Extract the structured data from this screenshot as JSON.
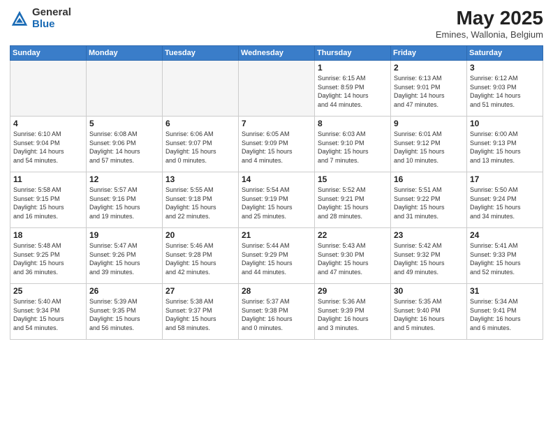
{
  "logo": {
    "general": "General",
    "blue": "Blue"
  },
  "title": "May 2025",
  "subtitle": "Emines, Wallonia, Belgium",
  "weekdays": [
    "Sunday",
    "Monday",
    "Tuesday",
    "Wednesday",
    "Thursday",
    "Friday",
    "Saturday"
  ],
  "weeks": [
    [
      {
        "day": "",
        "info": ""
      },
      {
        "day": "",
        "info": ""
      },
      {
        "day": "",
        "info": ""
      },
      {
        "day": "",
        "info": ""
      },
      {
        "day": "1",
        "info": "Sunrise: 6:15 AM\nSunset: 8:59 PM\nDaylight: 14 hours\nand 44 minutes."
      },
      {
        "day": "2",
        "info": "Sunrise: 6:13 AM\nSunset: 9:01 PM\nDaylight: 14 hours\nand 47 minutes."
      },
      {
        "day": "3",
        "info": "Sunrise: 6:12 AM\nSunset: 9:03 PM\nDaylight: 14 hours\nand 51 minutes."
      }
    ],
    [
      {
        "day": "4",
        "info": "Sunrise: 6:10 AM\nSunset: 9:04 PM\nDaylight: 14 hours\nand 54 minutes."
      },
      {
        "day": "5",
        "info": "Sunrise: 6:08 AM\nSunset: 9:06 PM\nDaylight: 14 hours\nand 57 minutes."
      },
      {
        "day": "6",
        "info": "Sunrise: 6:06 AM\nSunset: 9:07 PM\nDaylight: 15 hours\nand 0 minutes."
      },
      {
        "day": "7",
        "info": "Sunrise: 6:05 AM\nSunset: 9:09 PM\nDaylight: 15 hours\nand 4 minutes."
      },
      {
        "day": "8",
        "info": "Sunrise: 6:03 AM\nSunset: 9:10 PM\nDaylight: 15 hours\nand 7 minutes."
      },
      {
        "day": "9",
        "info": "Sunrise: 6:01 AM\nSunset: 9:12 PM\nDaylight: 15 hours\nand 10 minutes."
      },
      {
        "day": "10",
        "info": "Sunrise: 6:00 AM\nSunset: 9:13 PM\nDaylight: 15 hours\nand 13 minutes."
      }
    ],
    [
      {
        "day": "11",
        "info": "Sunrise: 5:58 AM\nSunset: 9:15 PM\nDaylight: 15 hours\nand 16 minutes."
      },
      {
        "day": "12",
        "info": "Sunrise: 5:57 AM\nSunset: 9:16 PM\nDaylight: 15 hours\nand 19 minutes."
      },
      {
        "day": "13",
        "info": "Sunrise: 5:55 AM\nSunset: 9:18 PM\nDaylight: 15 hours\nand 22 minutes."
      },
      {
        "day": "14",
        "info": "Sunrise: 5:54 AM\nSunset: 9:19 PM\nDaylight: 15 hours\nand 25 minutes."
      },
      {
        "day": "15",
        "info": "Sunrise: 5:52 AM\nSunset: 9:21 PM\nDaylight: 15 hours\nand 28 minutes."
      },
      {
        "day": "16",
        "info": "Sunrise: 5:51 AM\nSunset: 9:22 PM\nDaylight: 15 hours\nand 31 minutes."
      },
      {
        "day": "17",
        "info": "Sunrise: 5:50 AM\nSunset: 9:24 PM\nDaylight: 15 hours\nand 34 minutes."
      }
    ],
    [
      {
        "day": "18",
        "info": "Sunrise: 5:48 AM\nSunset: 9:25 PM\nDaylight: 15 hours\nand 36 minutes."
      },
      {
        "day": "19",
        "info": "Sunrise: 5:47 AM\nSunset: 9:26 PM\nDaylight: 15 hours\nand 39 minutes."
      },
      {
        "day": "20",
        "info": "Sunrise: 5:46 AM\nSunset: 9:28 PM\nDaylight: 15 hours\nand 42 minutes."
      },
      {
        "day": "21",
        "info": "Sunrise: 5:44 AM\nSunset: 9:29 PM\nDaylight: 15 hours\nand 44 minutes."
      },
      {
        "day": "22",
        "info": "Sunrise: 5:43 AM\nSunset: 9:30 PM\nDaylight: 15 hours\nand 47 minutes."
      },
      {
        "day": "23",
        "info": "Sunrise: 5:42 AM\nSunset: 9:32 PM\nDaylight: 15 hours\nand 49 minutes."
      },
      {
        "day": "24",
        "info": "Sunrise: 5:41 AM\nSunset: 9:33 PM\nDaylight: 15 hours\nand 52 minutes."
      }
    ],
    [
      {
        "day": "25",
        "info": "Sunrise: 5:40 AM\nSunset: 9:34 PM\nDaylight: 15 hours\nand 54 minutes."
      },
      {
        "day": "26",
        "info": "Sunrise: 5:39 AM\nSunset: 9:35 PM\nDaylight: 15 hours\nand 56 minutes."
      },
      {
        "day": "27",
        "info": "Sunrise: 5:38 AM\nSunset: 9:37 PM\nDaylight: 15 hours\nand 58 minutes."
      },
      {
        "day": "28",
        "info": "Sunrise: 5:37 AM\nSunset: 9:38 PM\nDaylight: 16 hours\nand 0 minutes."
      },
      {
        "day": "29",
        "info": "Sunrise: 5:36 AM\nSunset: 9:39 PM\nDaylight: 16 hours\nand 3 minutes."
      },
      {
        "day": "30",
        "info": "Sunrise: 5:35 AM\nSunset: 9:40 PM\nDaylight: 16 hours\nand 5 minutes."
      },
      {
        "day": "31",
        "info": "Sunrise: 5:34 AM\nSunset: 9:41 PM\nDaylight: 16 hours\nand 6 minutes."
      }
    ]
  ]
}
